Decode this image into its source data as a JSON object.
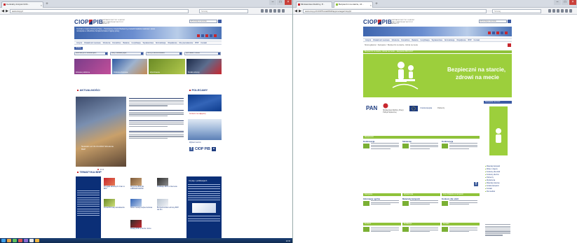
{
  "left_window": {
    "tabs": [
      {
        "title": "Centralny Instytut Ochr..."
      }
    ],
    "url": "www.ciop.pl",
    "search_placeholder": "Szukaj",
    "site": {
      "logo_text_left": "CIOP",
      "logo_text_right": "PIB",
      "logo_subtitle": "CENTRALNY INSTYTUT OCHRONY PRACY PAŃSTWOWY INSTYTUT BADAWCZY",
      "top_search_placeholder": "Wyszukaj w serwisie",
      "banner_text": "Centralny Instytut Ochrony Pracy – Państwowy Instytut Badawczy prowadzi badania naukowe i prace rozwojowe w dziedzinie bezpieczeństwa i higieny pracy",
      "menu": [
        "Instytut",
        "Działalność naukowa",
        "Szkolenia",
        "Doradztwo",
        "Badania",
        "Certyfikacja",
        "Wydawnictwa",
        "Normalizacja",
        "Współpraca",
        "Dla pracodawców",
        "BHP",
        "Kontakt"
      ],
      "pill": "Szukaj",
      "selects": [
        "Baza danych o substancjach",
        "Karty charakterystyki",
        "Normy zharmonizowane",
        "Spis badań i metod"
      ],
      "tiles": [
        {
          "label": "Zdrowie publiczne"
        },
        {
          "label": "Ochrona zbiorowa"
        },
        {
          "label": "Wyróżnienia"
        },
        {
          "label": "Środki ochrony"
        }
      ],
      "news_heading": "AKTUALNOŚCI",
      "news_caption": "Nowości od: 01.04.2016 Szkolenie BHP",
      "recommended_heading": "POLECAMY",
      "recommended_red": "Konkurs na najlepszy",
      "recommended_sub": "Wybierz termin",
      "social_label": "CIOP PIB",
      "bhp_heading": "TEMATYKA BHP",
      "bhp_items": [
        {
          "cap": "Przegląd aktualnych zmian w BHP"
        },
        {
          "cap": "Wytyczne BHP dla LABORATORIÓW"
        },
        {
          "cap": "Publikacje BHP w Internecie"
        },
        {
          "cap": "Portal BHP dla pracodawców"
        },
        {
          "cap": "Nowe metody bezpieczeństwa"
        },
        {
          "cap": "Bezpieczeństwo ochrony BHP dla firm"
        },
        {
          "cap": "Zasady BHP w biurze i domu"
        }
      ],
      "navy_heading": "Czytaj o publikacjach"
    },
    "taskbar_clock": "12:34"
  },
  "right_window": {
    "tabs": [
      {
        "title": "Ministerstwo Rodziny, P..."
      },
      {
        "title": "Bezpieczni na starcie, zd..."
      }
    ],
    "url": "www.ciop.pl/CIOPPortalWAR/appmanager/ciop/pl",
    "search_placeholder": "Szukaj",
    "site": {
      "logo_text_left": "CIOP",
      "logo_text_right": "PIB",
      "logo_subtitle": "CENTRALNY INSTYTUT OCHRONY PRACY PAŃSTWOWY INSTYTUT BADAWCZY",
      "top_search_placeholder": "Wyszukaj w serwisie",
      "menu": [
        "Instytut",
        "Działalność naukowa",
        "Szkolenia",
        "Doradztwo",
        "Badania",
        "Certyfikacja",
        "Wydawnictwa",
        "Normalizacja",
        "Współpraca",
        "BHP",
        "Kontakt"
      ],
      "breadcrumb": "Strona główna > Kampanie > Bezpieczni na starcie, zdrowi na mecie",
      "green_bar": "Bezpieczni na starcie, zdrowi na mecie – kampania 2016-2017",
      "hero_line1": "Bezpieczni na starcie,",
      "hero_line2": "zdrowi na mecie",
      "logos": [
        "PAN",
        "Ministerstwo Rodziny, Pracy i Polityki Społecznej",
        "Unia Europejska",
        "Partnerzy"
      ],
      "section_bar": "Aktualności",
      "cols": [
        {
          "head": "Konferencja"
        },
        {
          "head": "Szkolenie"
        },
        {
          "head": "Konferencja"
        }
      ],
      "bottom_bars": [
        "Kampanie",
        "Wydarzenia",
        "Inne działania w kampanii"
      ],
      "bottom_cols": [
        {
          "head": "Informacje ogólne"
        },
        {
          "head": "Materiały kampanii"
        },
        {
          "head": "Konkurs dla szkół"
        }
      ],
      "bottom_bars2": [
        "Konkurs",
        "Publikacje",
        "Kontakt"
      ],
      "side_heading": "Kampania na rzecz",
      "side_links": [
        "Materiały kampanii",
        "Wideo i zdjęcia",
        "Konkursy dla szkół",
        "Konkursy dla firm",
        "Partnerzy",
        "Wydarzenia",
        "Materiały prasowe",
        "Ankieta kampanii",
        "Kontakt",
        "Dla mediów"
      ]
    }
  }
}
